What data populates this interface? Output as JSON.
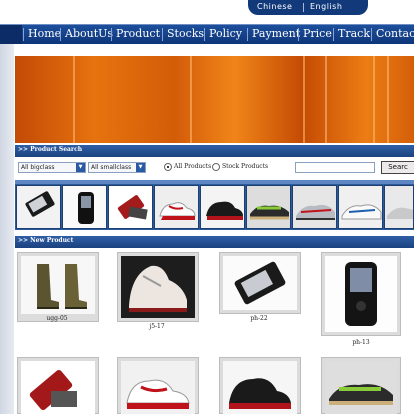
{
  "header": {
    "languages": [
      "Chinese",
      "English"
    ]
  },
  "nav": {
    "items": [
      "Home",
      "AboutUs",
      "Product",
      "Stocks",
      "Policy",
      "Payment",
      "Price",
      "Track",
      "Contact"
    ]
  },
  "search": {
    "title": ">> Product Search",
    "bigclass": "All bigclass",
    "smallclass": "All smallclass",
    "option_all": "All Products",
    "option_stock": "Stock Products",
    "button": "Searc"
  },
  "new_product": {
    "title": ">> New Product",
    "items": [
      {
        "label": "ugg-05"
      },
      {
        "label": "j5-17"
      },
      {
        "label": "ph-22"
      },
      {
        "label": "ph-13"
      }
    ]
  },
  "colors": {
    "nav": "#123a7a",
    "banner": "#e6730f",
    "bar": "#1b427f"
  }
}
